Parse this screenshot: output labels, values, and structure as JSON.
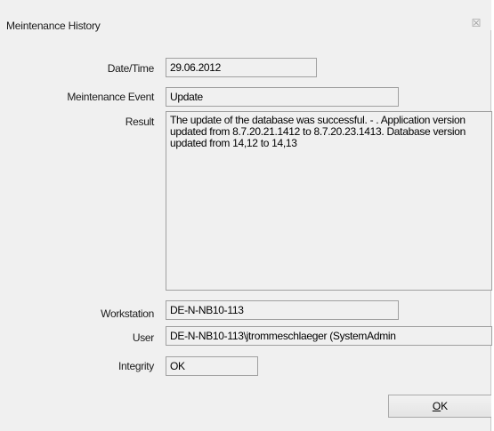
{
  "window": {
    "title": "Meintenance History",
    "close_glyph": "☒"
  },
  "fields": {
    "datetime": {
      "label": "Date/Time",
      "value": "29.06.2012"
    },
    "event": {
      "label": "Meintenance Event",
      "value": "Update"
    },
    "result": {
      "label": "Result",
      "value": "The update of the database was successful. - . Application version updated from 8.7.20.21.1412 to 8.7.20.23.1413. Database version updated from 14,12 to 14,13"
    },
    "workstation": {
      "label": "Workstation",
      "value": "DE-N-NB10-113"
    },
    "user": {
      "label": "User",
      "value": "DE-N-NB10-113\\jtrommeschlaeger (SystemAdmin"
    },
    "integrity": {
      "label": "Integrity",
      "value": "OK"
    }
  },
  "buttons": {
    "ok_mnemonic": "O",
    "ok_rest": "K"
  }
}
